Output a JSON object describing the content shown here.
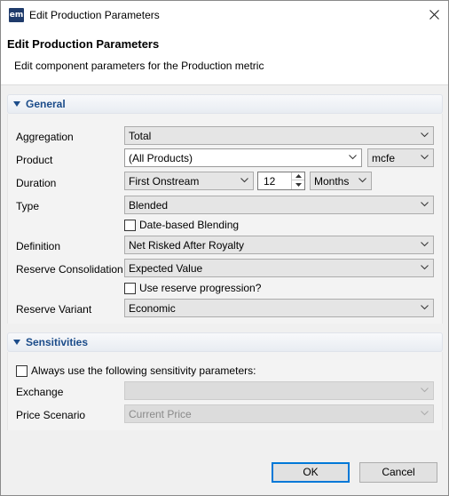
{
  "window": {
    "title": "Edit Production Parameters",
    "icon_text": "em"
  },
  "header": {
    "title": "Edit Production Parameters",
    "description": "Edit component parameters for the Production metric"
  },
  "general": {
    "title": "General",
    "aggregation": {
      "label": "Aggregation",
      "value": "Total"
    },
    "product": {
      "label": "Product",
      "value": "(All Products)",
      "unit": "mcfe"
    },
    "duration": {
      "label": "Duration",
      "value": "First Onstream",
      "number": "12",
      "unit": "Months"
    },
    "type": {
      "label": "Type",
      "value": "Blended"
    },
    "date_based_blending": {
      "label": "Date-based Blending",
      "checked": false
    },
    "definition": {
      "label": "Definition",
      "value": "Net Risked After Royalty"
    },
    "reserve_consolidation": {
      "label": "Reserve Consolidation",
      "value": "Expected Value"
    },
    "use_reserve_progression": {
      "label": "Use reserve progression?",
      "checked": false
    },
    "reserve_variant": {
      "label": "Reserve Variant",
      "value": "Economic"
    }
  },
  "sensitivities": {
    "title": "Sensitivities",
    "always_use": {
      "label": "Always use the following sensitivity parameters:",
      "checked": false
    },
    "exchange": {
      "label": "Exchange",
      "value": ""
    },
    "price_scenario": {
      "label": "Price Scenario",
      "value": "Current Price"
    }
  },
  "buttons": {
    "ok": "OK",
    "cancel": "Cancel"
  },
  "colors": {
    "accent": "#1b4c8a",
    "focus": "#0078d7"
  }
}
